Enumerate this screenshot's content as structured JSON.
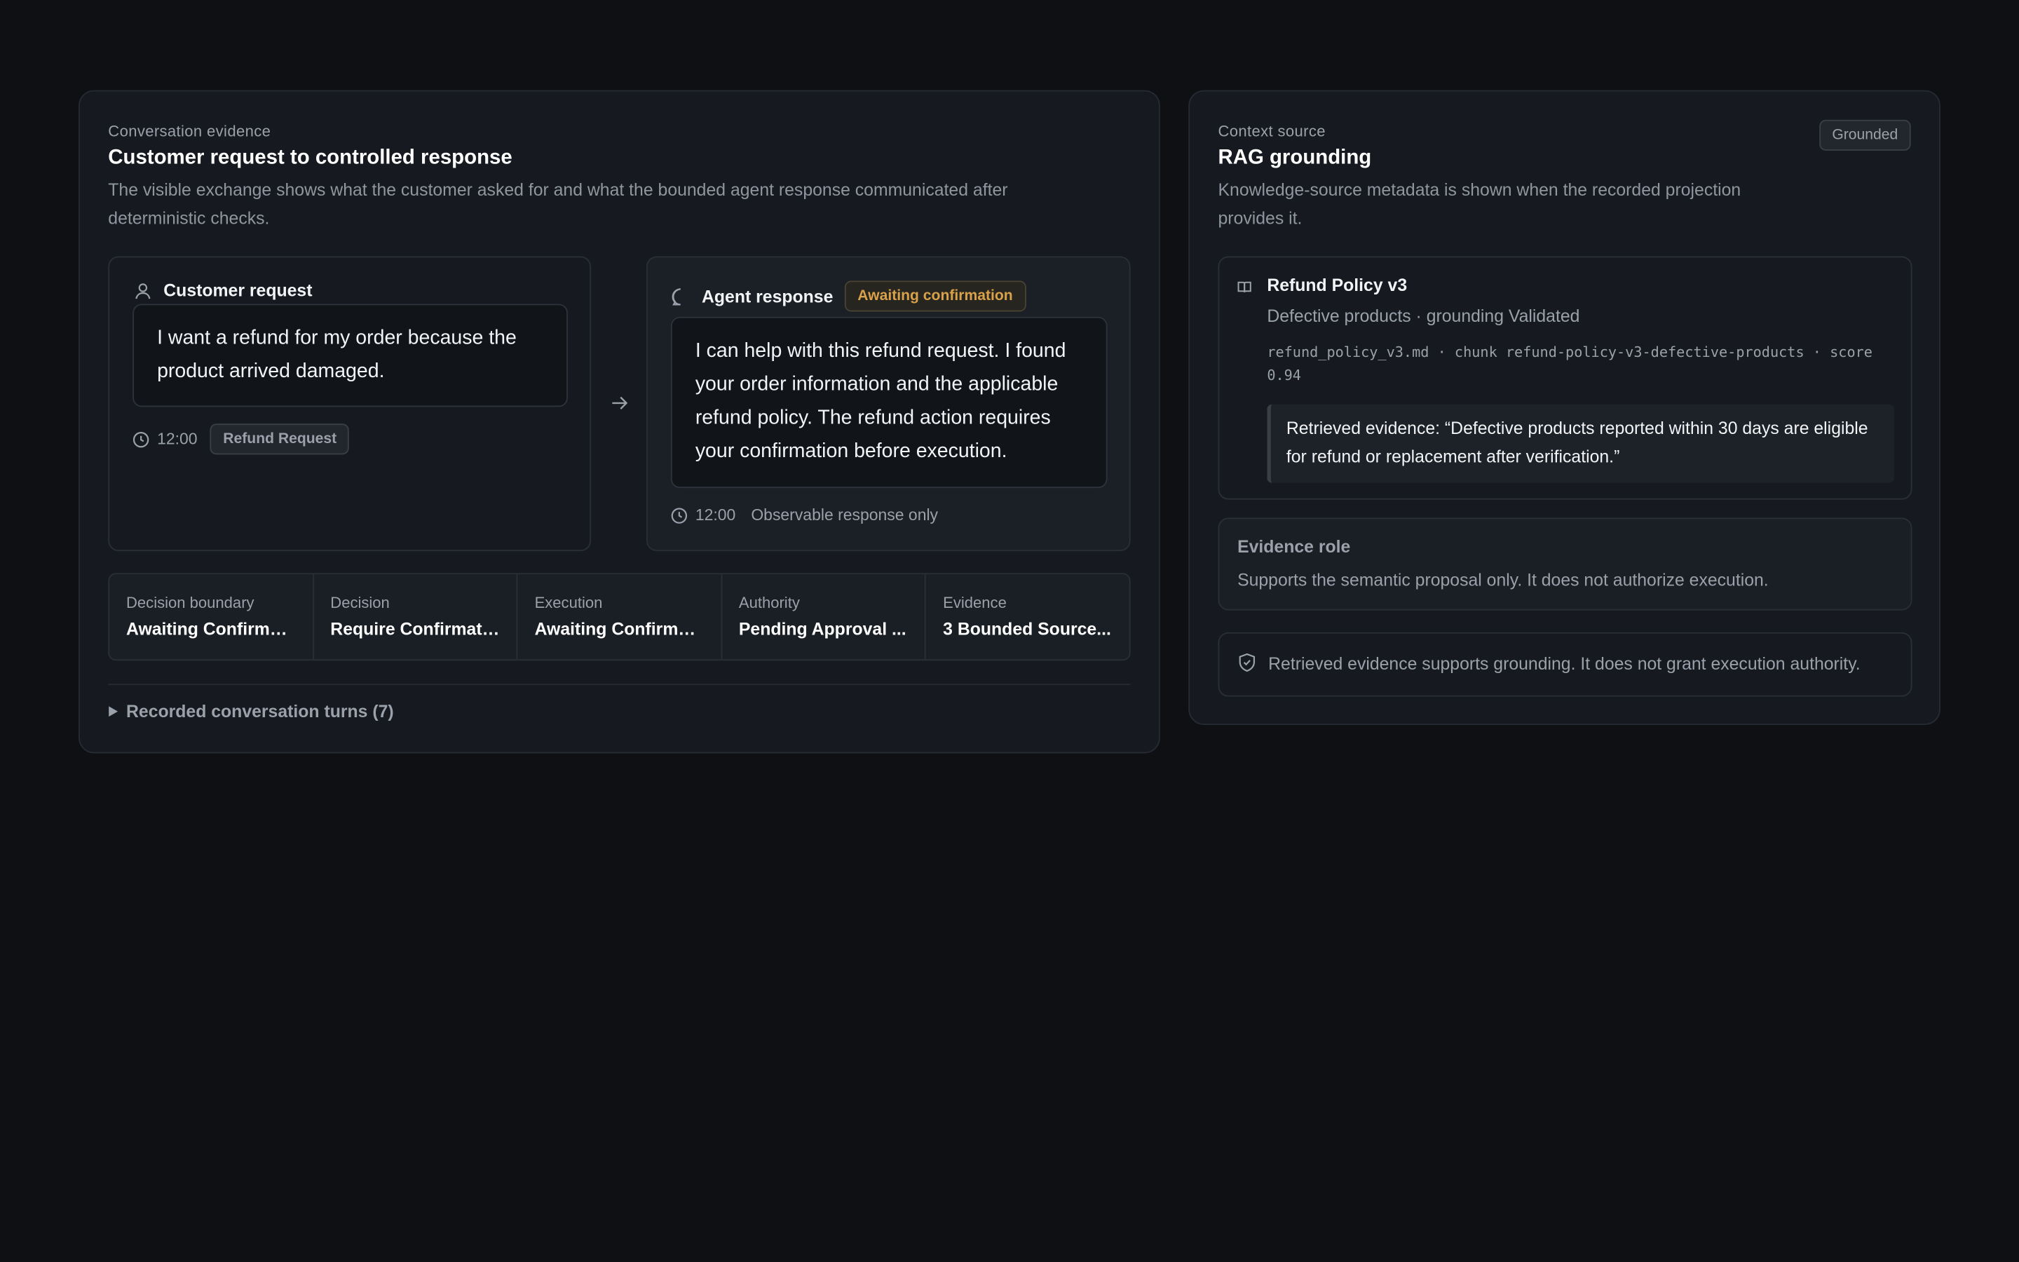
{
  "conversation": {
    "eyebrow": "Conversation evidence",
    "title": "Customer request to controlled response",
    "description": "The visible exchange shows what the customer asked for and what the bounded agent response communicated after deterministic checks.",
    "customer": {
      "label": "Customer request",
      "message": "I want a refund for my order because the product arrived damaged.",
      "time": "12:00",
      "tag": "Refund Request",
      "icon": "user-icon"
    },
    "agent": {
      "label": "Agent response",
      "status": "Awaiting confirmation",
      "status_color": "#d9a24a",
      "message": "I can help with this refund request. I found your order information and the applicable refund policy. The refund action requires your confirmation before execution.",
      "time": "12:00",
      "note": "Observable response only",
      "icon": "chat-bubble-icon"
    },
    "stats": [
      {
        "label": "Decision boundary",
        "value": "Awaiting Confirmat..."
      },
      {
        "label": "Decision",
        "value": "Require Confirmati..."
      },
      {
        "label": "Execution",
        "value": "Awaiting Confirmat..."
      },
      {
        "label": "Authority",
        "value": "Pending Approval ..."
      },
      {
        "label": "Evidence",
        "value": "3 Bounded Source..."
      }
    ],
    "turns_toggle": "Recorded conversation turns (7)"
  },
  "context": {
    "eyebrow": "Context source",
    "title": "RAG grounding",
    "badge": "Grounded",
    "description": "Knowledge-source metadata is shown when the recorded projection provides it.",
    "source": {
      "title": "Refund Policy v3",
      "subtitle": "Defective products · grounding Validated",
      "meta": "refund_policy_v3.md · chunk refund-policy-v3-defective-products · score 0.94",
      "evidence": "Retrieved evidence: “Defective products reported within 30 days are eligible for refund or replacement after verification.”",
      "icon": "book-icon"
    },
    "role": {
      "title": "Evidence role",
      "text": "Supports the semantic proposal only. It does not authorize execution."
    },
    "notice": {
      "text": "Retrieved evidence supports grounding. It does not grant execution authority.",
      "icon": "shield-check-icon"
    }
  }
}
